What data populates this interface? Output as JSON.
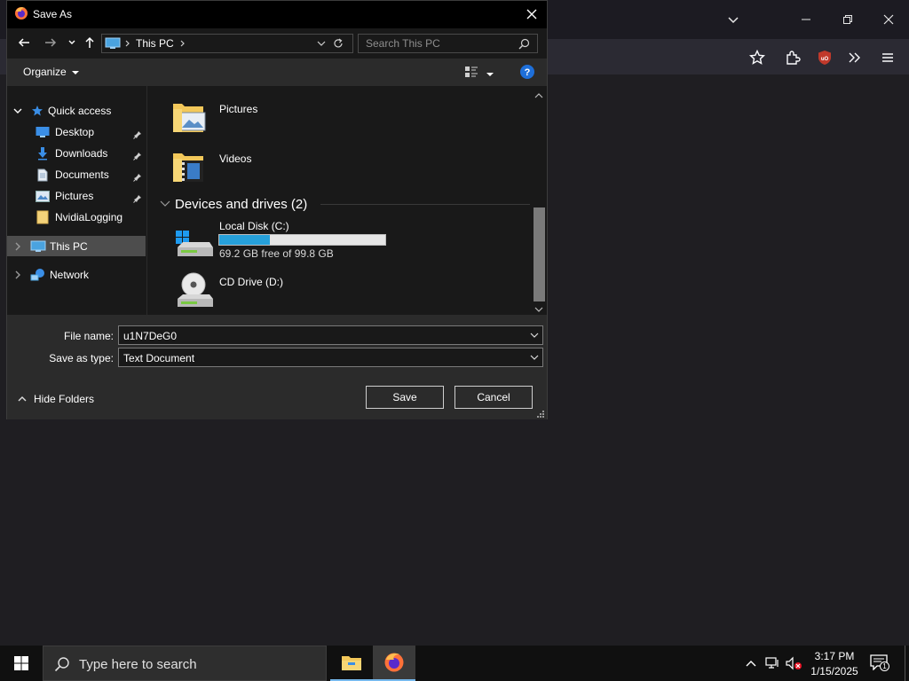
{
  "dialog": {
    "title": "Save As",
    "address": {
      "location": "This PC"
    },
    "search": {
      "placeholder": "Search This PC"
    },
    "toolbar": {
      "organize": "Organize"
    },
    "nav": {
      "quick_access": "Quick access",
      "items": [
        {
          "label": "Desktop"
        },
        {
          "label": "Downloads"
        },
        {
          "label": "Documents"
        },
        {
          "label": "Pictures"
        },
        {
          "label": "NvidiaLogging"
        }
      ],
      "this_pc": "This PC",
      "network": "Network"
    },
    "content": {
      "folders": [
        {
          "label": "Pictures"
        },
        {
          "label": "Videos"
        }
      ],
      "group_header": "Devices and drives (2)",
      "drives": [
        {
          "label": "Local Disk (C:)",
          "free_text": "69.2 GB free of 99.8 GB",
          "used_fraction": 0.307,
          "bar_color": "#26a0da"
        },
        {
          "label": "CD Drive (D:)"
        }
      ]
    },
    "fields": {
      "file_name_label": "File name:",
      "file_name_value": "u1N7DeG0",
      "type_label": "Save as type:",
      "type_value": "Text Document"
    },
    "hide_folders": "Hide Folders",
    "save_label": "Save",
    "cancel_label": "Cancel"
  },
  "taskbar": {
    "search_placeholder": "Type here to search",
    "time": "3:17 PM",
    "date": "1/15/2025",
    "notification_count": "1"
  },
  "colors": {
    "accent": "#26a0da",
    "firefox": "#ff7139",
    "ublock": "#c0392b"
  }
}
